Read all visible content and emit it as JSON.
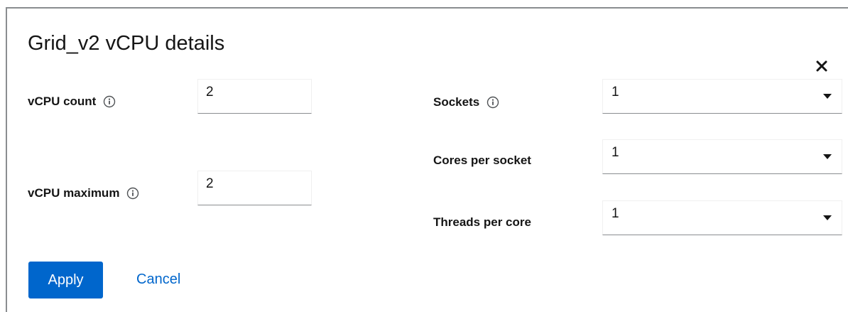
{
  "dialog": {
    "title": "Grid_v2 vCPU details",
    "close_icon": "close-icon"
  },
  "left_fields": {
    "vcpu_count": {
      "label": "vCPU count",
      "value": "2",
      "icon": "info-icon"
    },
    "vcpu_maximum": {
      "label": "vCPU maximum",
      "value": "2",
      "icon": "info-icon"
    }
  },
  "right_fields": {
    "sockets": {
      "label": "Sockets",
      "value": "1",
      "icon": "info-icon"
    },
    "cores_per_socket": {
      "label": "Cores per socket",
      "value": "1"
    },
    "threads_per_core": {
      "label": "Threads per core",
      "value": "1"
    }
  },
  "actions": {
    "apply_label": "Apply",
    "cancel_label": "Cancel"
  },
  "colors": {
    "primary": "#0066cc",
    "text": "#151515",
    "border": "#8a8d90"
  }
}
